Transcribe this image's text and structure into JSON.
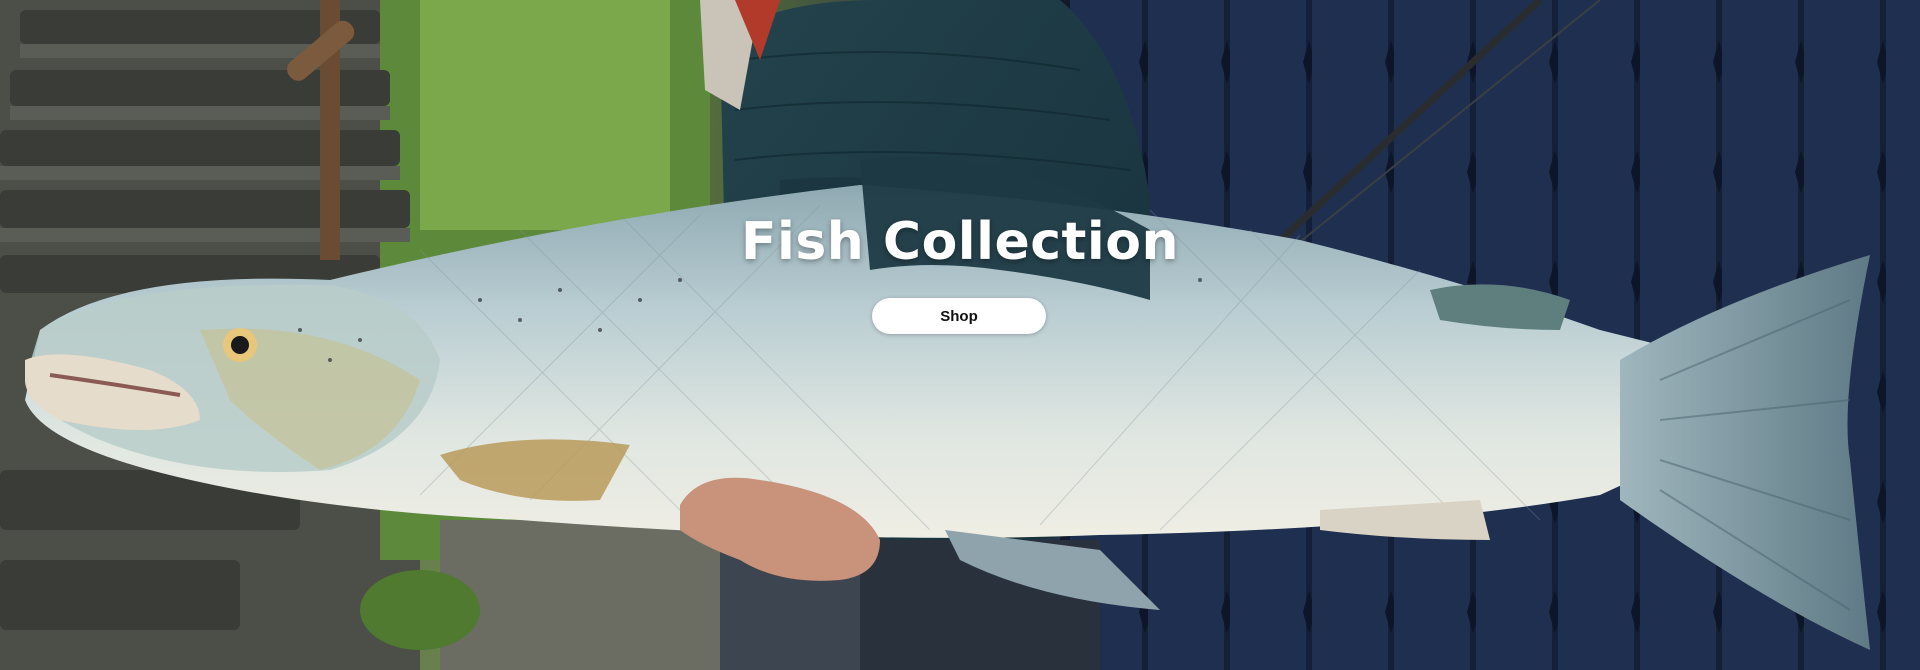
{
  "hero": {
    "title": "Fish Collection",
    "shop_label": "Shop"
  },
  "colors": {
    "title_text": "#ffffff",
    "button_bg": "#ffffff",
    "button_text": "#111111",
    "fence_blue": "#1f2f50",
    "fish_silver": "#c8d6d8",
    "jacket": "#1f3b45"
  }
}
